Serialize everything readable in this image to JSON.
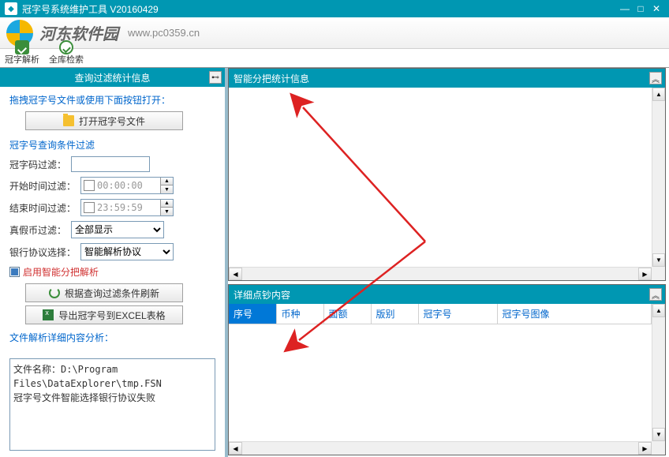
{
  "window": {
    "title": "冠字号系统维护工具 V20160429",
    "icon": "app-icon"
  },
  "banner": {
    "brand": "河东软件园",
    "url": "www.pc0359.cn"
  },
  "toolbar": {
    "parse_label": "冠字解析",
    "search_label": "全库检索"
  },
  "left": {
    "header": "查询过滤统计信息",
    "drag_label": "拖拽冠字号文件或使用下面按钮打开：",
    "open_btn": "打开冠字号文件",
    "filter_label": "冠字号查询条件过滤",
    "code_filter": "冠字码过滤：",
    "code_filter_value": "",
    "start_time": "开始时间过滤：",
    "start_time_value": "00:00:00",
    "end_time": "结束时间过滤：",
    "end_time_value": "23:59:59",
    "real_fake": "真假币过滤：",
    "real_fake_value": "全部显示",
    "protocol": "银行协议选择：",
    "protocol_value": "智能解析协议",
    "enable_smart": "启用智能分把解析",
    "refresh_btn": "根据查询过滤条件刷新",
    "export_btn": "导出冠字号到EXCEL表格",
    "analysis_label": "文件解析详细内容分析：",
    "detail_line1": "文件名称：D:\\Program Files\\DataExplorer\\tmp.FSN",
    "detail_line2": "",
    "detail_line3": "冠字号文件智能选择银行协议失败"
  },
  "right": {
    "stats_header": "智能分把统计信息",
    "detail_header": "详细点钞内容",
    "columns": [
      "序号",
      "币种",
      "面额",
      "版别",
      "冠字号",
      "冠字号图像"
    ]
  }
}
